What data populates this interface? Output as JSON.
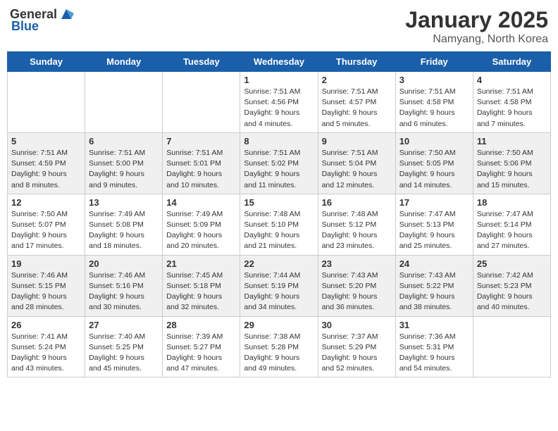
{
  "header": {
    "logo_general": "General",
    "logo_blue": "Blue",
    "month": "January 2025",
    "location": "Namyang, North Korea"
  },
  "days_of_week": [
    "Sunday",
    "Monday",
    "Tuesday",
    "Wednesday",
    "Thursday",
    "Friday",
    "Saturday"
  ],
  "weeks": [
    [
      {
        "day": "",
        "info": ""
      },
      {
        "day": "",
        "info": ""
      },
      {
        "day": "",
        "info": ""
      },
      {
        "day": "1",
        "info": "Sunrise: 7:51 AM\nSunset: 4:56 PM\nDaylight: 9 hours\nand 4 minutes."
      },
      {
        "day": "2",
        "info": "Sunrise: 7:51 AM\nSunset: 4:57 PM\nDaylight: 9 hours\nand 5 minutes."
      },
      {
        "day": "3",
        "info": "Sunrise: 7:51 AM\nSunset: 4:58 PM\nDaylight: 9 hours\nand 6 minutes."
      },
      {
        "day": "4",
        "info": "Sunrise: 7:51 AM\nSunset: 4:58 PM\nDaylight: 9 hours\nand 7 minutes."
      }
    ],
    [
      {
        "day": "5",
        "info": "Sunrise: 7:51 AM\nSunset: 4:59 PM\nDaylight: 9 hours\nand 8 minutes."
      },
      {
        "day": "6",
        "info": "Sunrise: 7:51 AM\nSunset: 5:00 PM\nDaylight: 9 hours\nand 9 minutes."
      },
      {
        "day": "7",
        "info": "Sunrise: 7:51 AM\nSunset: 5:01 PM\nDaylight: 9 hours\nand 10 minutes."
      },
      {
        "day": "8",
        "info": "Sunrise: 7:51 AM\nSunset: 5:02 PM\nDaylight: 9 hours\nand 11 minutes."
      },
      {
        "day": "9",
        "info": "Sunrise: 7:51 AM\nSunset: 5:04 PM\nDaylight: 9 hours\nand 12 minutes."
      },
      {
        "day": "10",
        "info": "Sunrise: 7:50 AM\nSunset: 5:05 PM\nDaylight: 9 hours\nand 14 minutes."
      },
      {
        "day": "11",
        "info": "Sunrise: 7:50 AM\nSunset: 5:06 PM\nDaylight: 9 hours\nand 15 minutes."
      }
    ],
    [
      {
        "day": "12",
        "info": "Sunrise: 7:50 AM\nSunset: 5:07 PM\nDaylight: 9 hours\nand 17 minutes."
      },
      {
        "day": "13",
        "info": "Sunrise: 7:49 AM\nSunset: 5:08 PM\nDaylight: 9 hours\nand 18 minutes."
      },
      {
        "day": "14",
        "info": "Sunrise: 7:49 AM\nSunset: 5:09 PM\nDaylight: 9 hours\nand 20 minutes."
      },
      {
        "day": "15",
        "info": "Sunrise: 7:48 AM\nSunset: 5:10 PM\nDaylight: 9 hours\nand 21 minutes."
      },
      {
        "day": "16",
        "info": "Sunrise: 7:48 AM\nSunset: 5:12 PM\nDaylight: 9 hours\nand 23 minutes."
      },
      {
        "day": "17",
        "info": "Sunrise: 7:47 AM\nSunset: 5:13 PM\nDaylight: 9 hours\nand 25 minutes."
      },
      {
        "day": "18",
        "info": "Sunrise: 7:47 AM\nSunset: 5:14 PM\nDaylight: 9 hours\nand 27 minutes."
      }
    ],
    [
      {
        "day": "19",
        "info": "Sunrise: 7:46 AM\nSunset: 5:15 PM\nDaylight: 9 hours\nand 28 minutes."
      },
      {
        "day": "20",
        "info": "Sunrise: 7:46 AM\nSunset: 5:16 PM\nDaylight: 9 hours\nand 30 minutes."
      },
      {
        "day": "21",
        "info": "Sunrise: 7:45 AM\nSunset: 5:18 PM\nDaylight: 9 hours\nand 32 minutes."
      },
      {
        "day": "22",
        "info": "Sunrise: 7:44 AM\nSunset: 5:19 PM\nDaylight: 9 hours\nand 34 minutes."
      },
      {
        "day": "23",
        "info": "Sunrise: 7:43 AM\nSunset: 5:20 PM\nDaylight: 9 hours\nand 36 minutes."
      },
      {
        "day": "24",
        "info": "Sunrise: 7:43 AM\nSunset: 5:22 PM\nDaylight: 9 hours\nand 38 minutes."
      },
      {
        "day": "25",
        "info": "Sunrise: 7:42 AM\nSunset: 5:23 PM\nDaylight: 9 hours\nand 40 minutes."
      }
    ],
    [
      {
        "day": "26",
        "info": "Sunrise: 7:41 AM\nSunset: 5:24 PM\nDaylight: 9 hours\nand 43 minutes."
      },
      {
        "day": "27",
        "info": "Sunrise: 7:40 AM\nSunset: 5:25 PM\nDaylight: 9 hours\nand 45 minutes."
      },
      {
        "day": "28",
        "info": "Sunrise: 7:39 AM\nSunset: 5:27 PM\nDaylight: 9 hours\nand 47 minutes."
      },
      {
        "day": "29",
        "info": "Sunrise: 7:38 AM\nSunset: 5:28 PM\nDaylight: 9 hours\nand 49 minutes."
      },
      {
        "day": "30",
        "info": "Sunrise: 7:37 AM\nSunset: 5:29 PM\nDaylight: 9 hours\nand 52 minutes."
      },
      {
        "day": "31",
        "info": "Sunrise: 7:36 AM\nSunset: 5:31 PM\nDaylight: 9 hours\nand 54 minutes."
      },
      {
        "day": "",
        "info": ""
      }
    ]
  ]
}
